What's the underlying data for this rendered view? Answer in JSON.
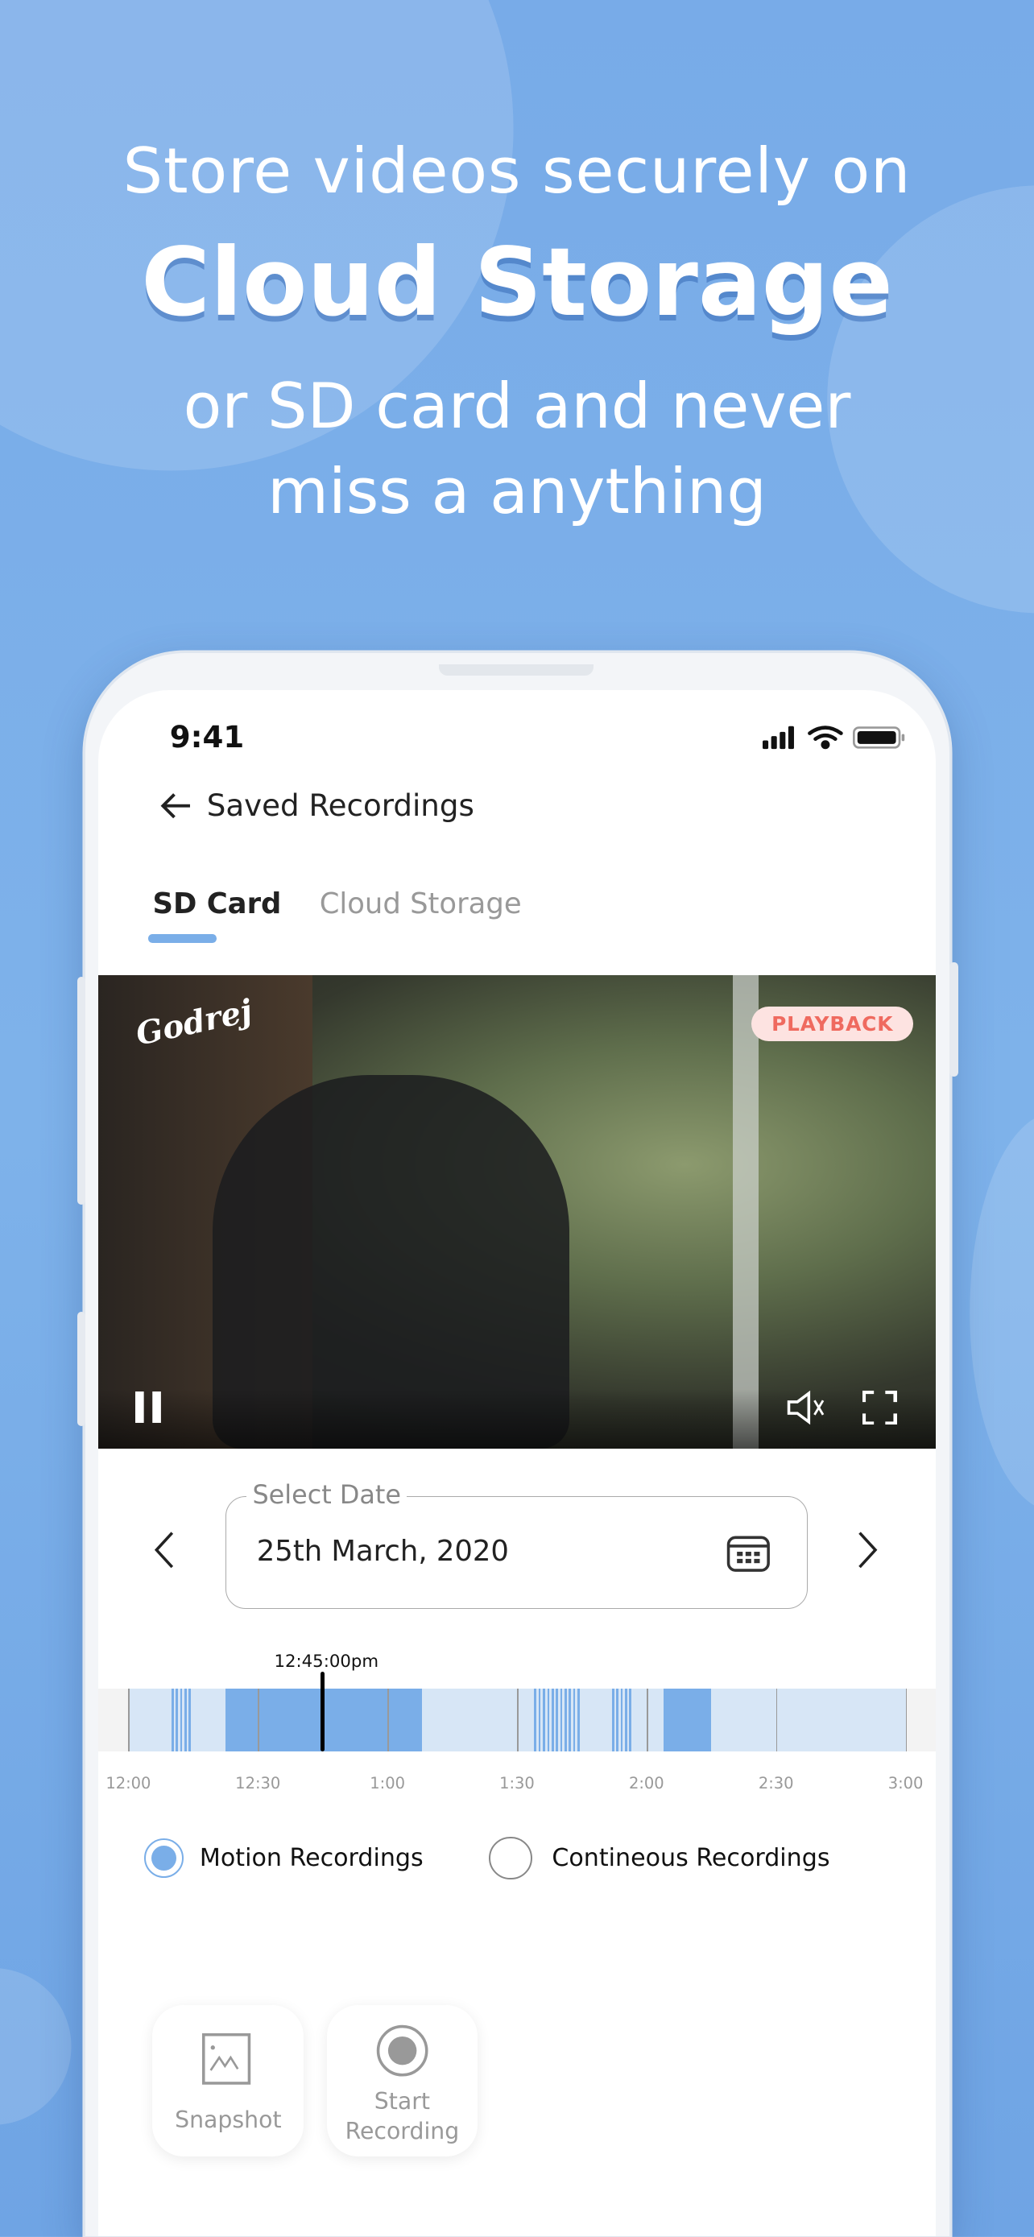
{
  "hero": {
    "line1": "Store videos securely on",
    "line2": "Cloud Storage",
    "line3": "or SD card and never",
    "line4": "miss a anything"
  },
  "status_bar": {
    "time": "9:41",
    "icons": [
      "signal-icon",
      "wifi-icon",
      "battery-icon"
    ]
  },
  "header": {
    "title": "Saved Recordings",
    "back_icon": "arrow-left-icon"
  },
  "tabs": [
    {
      "label": "SD Card",
      "active": true
    },
    {
      "label": "Cloud Storage",
      "active": false
    }
  ],
  "video": {
    "logo": "Godrej",
    "badge": "PLAYBACK",
    "controls": [
      "pause-icon",
      "volume-icon",
      "fullscreen-icon"
    ]
  },
  "date_picker": {
    "label": "Select Date",
    "value": "25th March, 2020",
    "icon": "calendar-icon"
  },
  "timeline": {
    "current_time": "12:45:00pm",
    "ticks": [
      "12:00",
      "12:30",
      "1:00",
      "1:30",
      "2:00",
      "2:30",
      "3:00"
    ],
    "range_minutes": [
      0,
      180
    ],
    "current_minutes": 45,
    "solid_segments": [
      [
        22.5,
        68
      ],
      [
        124,
        135
      ]
    ],
    "striped_segments": [
      [
        10,
        14
      ],
      [
        94,
        104
      ],
      [
        112,
        116
      ]
    ],
    "colors": {
      "track": "#d7e6f6",
      "recorded": "#7aaee8",
      "playhead": "#000000"
    }
  },
  "recording_types": [
    {
      "label": "Motion Recordings",
      "selected": true
    },
    {
      "label": "Contineous Recordings",
      "selected": false
    }
  ],
  "actions": [
    {
      "label": "Snapshot",
      "icon": "image-icon"
    },
    {
      "label": "Start",
      "label2": "Recording",
      "icon": "record-icon"
    }
  ],
  "accent": "#7aaee8"
}
